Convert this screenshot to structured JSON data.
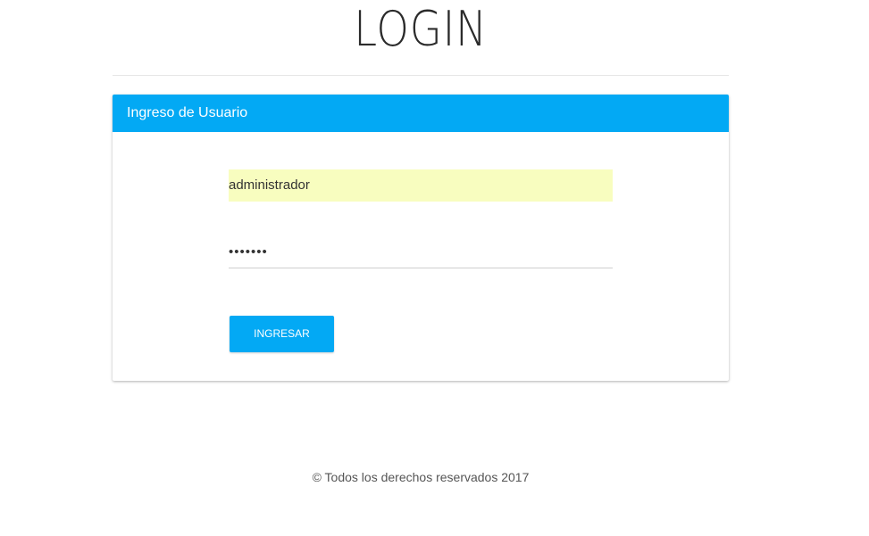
{
  "page": {
    "title": "LOGIN"
  },
  "login_panel": {
    "heading": "Ingreso de Usuario",
    "username_value": "administrador",
    "password_value": "•••••••",
    "submit_label": "INGRESAR"
  },
  "footer": {
    "text": "© Todos los derechos reservados 2017"
  },
  "colors": {
    "accent": "#03a9f4",
    "autofill_background": "#f8fdbf"
  }
}
